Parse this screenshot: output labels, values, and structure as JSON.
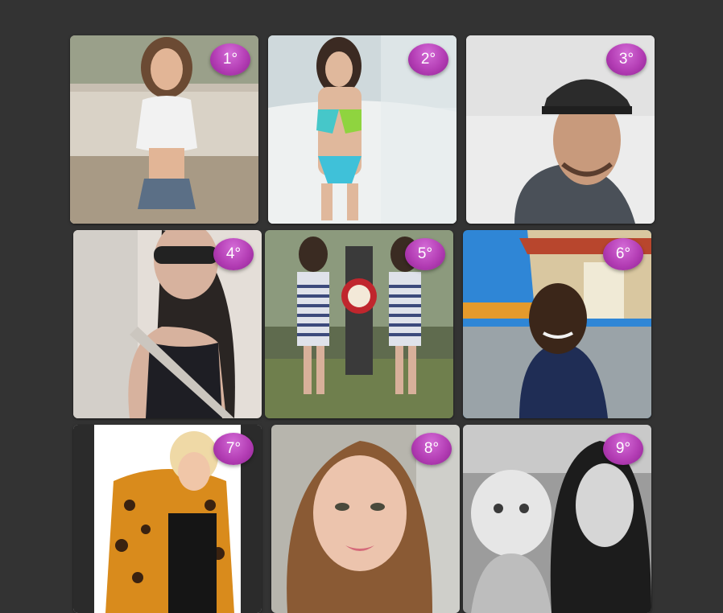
{
  "ranking": {
    "cards": [
      {
        "rank": "1°",
        "photo": "woman-white-crop-top-denim-shorts"
      },
      {
        "rank": "2°",
        "photo": "woman-teal-bikini-beach"
      },
      {
        "rank": "3°",
        "photo": "man-baseball-cap-selfie"
      },
      {
        "rank": "4°",
        "photo": "woman-sunglasses-car-selfie"
      },
      {
        "rank": "5°",
        "photo": "woman-striped-dress-mirrored"
      },
      {
        "rank": "6°",
        "photo": "man-selfie-temple"
      },
      {
        "rank": "7°",
        "photo": "woman-leopard-jacket"
      },
      {
        "rank": "8°",
        "photo": "woman-car-selfie"
      },
      {
        "rank": "9°",
        "photo": "woman-with-baby-bw"
      }
    ]
  },
  "colors": {
    "page_background": "#333333",
    "badge_purple": "#b43eb5",
    "badge_text": "#ffffff"
  }
}
